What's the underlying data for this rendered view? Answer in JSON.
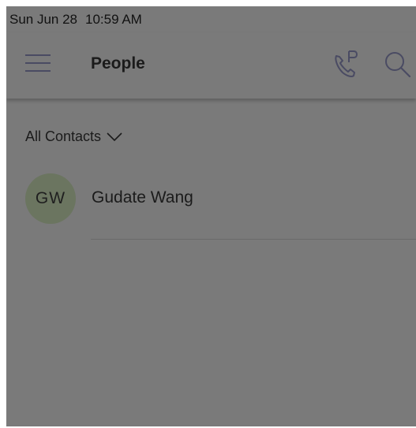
{
  "status_bar": {
    "date": "Sun Jun 28",
    "time": "10:59 AM"
  },
  "app_bar": {
    "title": "People",
    "icons": {
      "menu": "menu-icon",
      "call_park": "call-park-icon",
      "search": "search-icon"
    }
  },
  "filter": {
    "label": "All Contacts"
  },
  "contacts": [
    {
      "initials": "GW",
      "name": "Gudate Wang"
    }
  ],
  "colors": {
    "overlay_background": "#7a7a7a",
    "avatar_background": "#6b7560",
    "icon_color": "#4a4b63"
  }
}
